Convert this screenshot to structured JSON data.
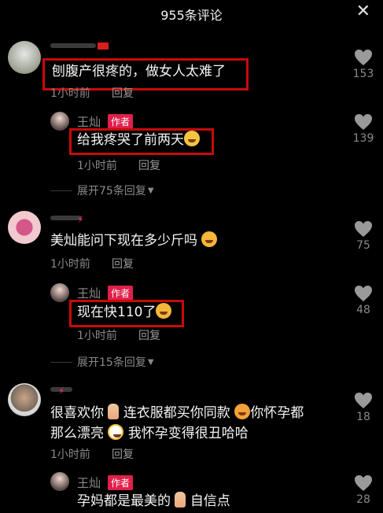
{
  "header": {
    "title": "955条评论",
    "close_icon": "close-icon"
  },
  "comments": [
    {
      "text": "刨腹产很疼的，做女人太难了",
      "time": "1小时前",
      "reply": "回复",
      "likes": "153",
      "reply_item": {
        "name": "王灿",
        "badge": "作者",
        "text": "给我疼哭了前两天",
        "time": "1小时前",
        "reply": "回复",
        "likes": "139"
      },
      "expand": "展开75条回复"
    },
    {
      "text": "美灿能问下现在多少斤吗",
      "time": "1小时前",
      "reply": "回复",
      "likes": "75",
      "reply_item": {
        "name": "王灿",
        "badge": "作者",
        "text": "现在快110了",
        "time": "1小时前",
        "reply": "回复",
        "likes": "48"
      },
      "expand": "展开15条回复"
    },
    {
      "text_line1a": "很喜欢你",
      "text_line1b": "连衣服都买你同款",
      "text_line1c": "你怀孕都",
      "text_line2a": "那么漂亮",
      "text_line2b": "我怀孕变得很丑哈哈",
      "time": "1小时前",
      "reply": "回复",
      "likes": "18",
      "reply_item": {
        "name": "王灿",
        "badge": "作者",
        "text_a": "孕妈都是最美的",
        "text_b": "自信点",
        "likes": "28"
      }
    }
  ],
  "colors": {
    "background": "#000000",
    "author_badge": "#e0204a",
    "highlight": "#c80a0a",
    "muted": "#8a8a8a"
  }
}
